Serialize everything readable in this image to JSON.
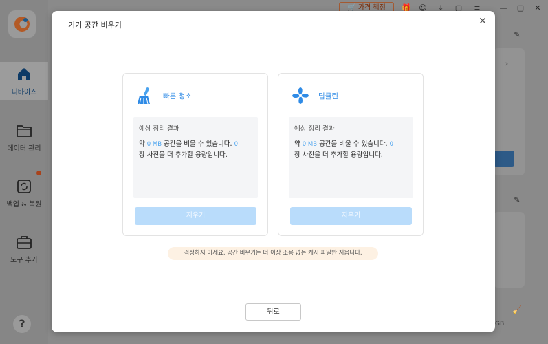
{
  "sidebar": {
    "items": [
      {
        "label": "디바이스",
        "icon": "home-icon"
      },
      {
        "label": "데이터 관리",
        "icon": "folder-icon"
      },
      {
        "label": "백업 & 복원",
        "icon": "backup-restore-icon"
      },
      {
        "label": "도구 추가",
        "icon": "toolbox-icon"
      }
    ],
    "help_label": "?"
  },
  "topbar": {
    "price_label": "가격 책정"
  },
  "background": {
    "storage_text": "GB"
  },
  "modal": {
    "title": "기기 공간 비우기",
    "close_symbol": "✕",
    "panels": [
      {
        "title": "빠른 청소",
        "icon": "broom-icon",
        "result_label": "예상 정리 결과",
        "text_prefix": "약 ",
        "size_value": "0 MB",
        "text_mid": " 공간을 비울 수 있습니다. ",
        "photo_count": "0",
        "text_suffix": "장 사진을 더 추가할 용량입니다.",
        "button_label": "지우기"
      },
      {
        "title": "딥클린",
        "icon": "fan-icon",
        "result_label": "예상 정리 결과",
        "text_prefix": "약 ",
        "size_value": "0 MB",
        "text_mid": " 공간을 비울 수 있습니다. ",
        "photo_count": "0",
        "text_suffix": "장 사진을 더 추가할 용량입니다.",
        "button_label": "지우기"
      }
    ],
    "notice": "걱정하지 마세요. 공간 비우기는 더 이상 소용 없는 캐시 파일만 지웁니다.",
    "back_label": "뒤로"
  },
  "colors": {
    "accent": "#2f8be6",
    "button_disabled": "#b9dcfb",
    "notice_bg": "#fdf1e3"
  }
}
